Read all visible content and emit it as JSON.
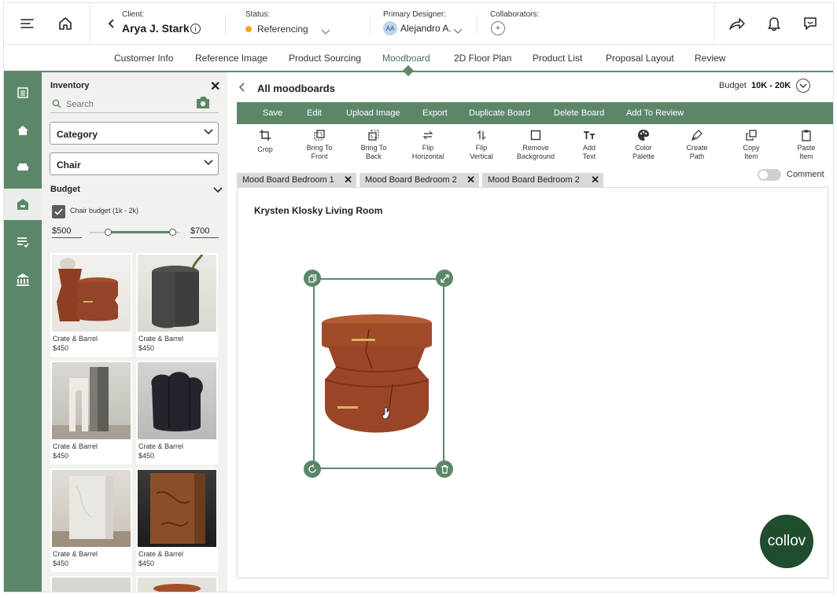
{
  "header": {
    "client_label": "Client:",
    "client_name": "Arya J. Stark",
    "status_label": "Status:",
    "status_value": "Referencing",
    "designer_label": "Primary Designer:",
    "designer_initials": "AA",
    "designer_name": "Alejandro A.",
    "collaborators_label": "Collaborators:",
    "collaborators_add": "+"
  },
  "tabs": [
    "Customer Info",
    "Reference Image",
    "Product Sourcing",
    "Moodboard",
    "2D Floor Plan",
    "Product List",
    "Proposal Layout",
    "Review"
  ],
  "active_tab": "Moodboard",
  "inventory": {
    "title": "Inventory",
    "search_placeholder": "Search",
    "category": "Category",
    "type": "Chair",
    "budget_label": "Budget",
    "checkbox_label": "Chair budget (1k - 2k)",
    "min_price": "$500",
    "max_price": "$700",
    "products": [
      {
        "brand": "Crate & Barrel",
        "price": "$450"
      },
      {
        "brand": "Crate & Barrel",
        "price": "$450"
      },
      {
        "brand": "Crate & Barrel",
        "price": "$450"
      },
      {
        "brand": "Crate & Barrel",
        "price": "$450"
      },
      {
        "brand": "Crate & Barrel",
        "price": "$450"
      },
      {
        "brand": "Crate & Barrel",
        "price": "$450"
      }
    ]
  },
  "board": {
    "back_label": "All moodboards",
    "budget_label": "Budget",
    "budget_value": "10K - 20K",
    "actions": [
      "Save",
      "Edit",
      "Upload Image",
      "Export",
      "Duplicate Board",
      "Delete Board",
      "Add To Review"
    ],
    "tools": [
      {
        "line1": "Crop",
        "line2": ""
      },
      {
        "line1": "Bring To",
        "line2": "Front"
      },
      {
        "line1": "Bring To",
        "line2": "Back"
      },
      {
        "line1": "Flip",
        "line2": "Horizontal"
      },
      {
        "line1": "Flip",
        "line2": "Vertical"
      },
      {
        "line1": "Remove",
        "line2": "Background"
      },
      {
        "line1": "Add",
        "line2": "Text"
      },
      {
        "line1": "Color",
        "line2": "Palette"
      },
      {
        "line1": "Create",
        "line2": "Path"
      },
      {
        "line1": "Copy",
        "line2": "Item"
      },
      {
        "line1": "Paste",
        "line2": "Item"
      }
    ],
    "board_tabs": [
      "Mood Board Bedroom 1",
      "Mood Board Bedroom 2",
      "Mood Board Bedroom 2"
    ],
    "comment_label": "Comment",
    "canvas_title": "Krysten Klosky Living Room",
    "logo_text": "collov"
  },
  "colors": {
    "accent": "#5b8768",
    "status_dot": "#f3a71d",
    "logo": "#1f4d2e"
  }
}
